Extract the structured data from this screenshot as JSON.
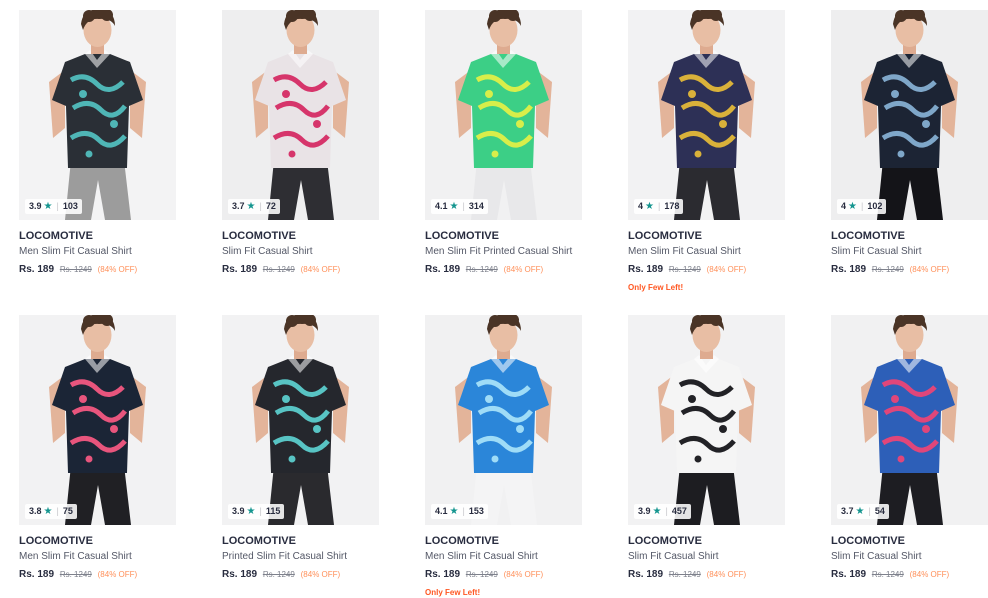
{
  "products": [
    {
      "brand": "LOCOMOTIVE",
      "name": "Men Slim Fit Casual Shirt",
      "price": "Rs. 189",
      "mrp": "Rs. 1249",
      "discount": "(84% OFF)",
      "rating": "3.9",
      "count": "103",
      "stock": "",
      "bg": "#f3f3f4",
      "shirt": "#2a2f36",
      "accent": "#4fb6b6",
      "pants": "#9c9c9c"
    },
    {
      "brand": "LOCOMOTIVE",
      "name": "Slim Fit Casual Shirt",
      "price": "Rs. 189",
      "mrp": "Rs. 1249",
      "discount": "(84% OFF)",
      "rating": "3.7",
      "count": "72",
      "stock": "",
      "bg": "#eeeeef",
      "shirt": "#e9e3e6",
      "accent": "#d6356b",
      "pants": "#2e2e33"
    },
    {
      "brand": "LOCOMOTIVE",
      "name": "Men Slim Fit Printed Casual Shirt",
      "price": "Rs. 189",
      "mrp": "Rs. 1249",
      "discount": "(84% OFF)",
      "rating": "4.1",
      "count": "314",
      "stock": "",
      "bg": "#f1f1f2",
      "shirt": "#3ccf86",
      "accent": "#d8ee4a",
      "pants": "#e8e8ea"
    },
    {
      "brand": "LOCOMOTIVE",
      "name": "Men Slim Fit Casual Shirt",
      "price": "Rs. 189",
      "mrp": "Rs. 1249",
      "discount": "(84% OFF)",
      "rating": "4",
      "count": "178",
      "stock": "Only Few Left!",
      "bg": "#f2f2f3",
      "shirt": "#2d3056",
      "accent": "#d9b13a",
      "pants": "#2b2b30"
    },
    {
      "brand": "LOCOMOTIVE",
      "name": "Slim Fit Casual Shirt",
      "price": "Rs. 189",
      "mrp": "Rs. 1249",
      "discount": "(84% OFF)",
      "rating": "4",
      "count": "102",
      "stock": "",
      "bg": "#eeeeef",
      "shirt": "#1c2434",
      "accent": "#7fa7c9",
      "pants": "#141418"
    },
    {
      "brand": "LOCOMOTIVE",
      "name": "Men Slim Fit Casual Shirt",
      "price": "Rs. 189",
      "mrp": "Rs. 1249",
      "discount": "(84% OFF)",
      "rating": "3.8",
      "count": "75",
      "stock": "",
      "bg": "#f2f2f3",
      "shirt": "#1b2536",
      "accent": "#e8557d",
      "pants": "#202024"
    },
    {
      "brand": "LOCOMOTIVE",
      "name": "Printed Slim Fit Casual Shirt",
      "price": "Rs. 189",
      "mrp": "Rs. 1249",
      "discount": "(84% OFF)",
      "rating": "3.9",
      "count": "115",
      "stock": "",
      "bg": "#f2f2f3",
      "shirt": "#25272d",
      "accent": "#58c4c4",
      "pants": "#2a2a2e"
    },
    {
      "brand": "LOCOMOTIVE",
      "name": "Men Slim Fit Casual Shirt",
      "price": "Rs. 189",
      "mrp": "Rs. 1249",
      "discount": "(84% OFF)",
      "rating": "4.1",
      "count": "153",
      "stock": "Only Few Left!",
      "bg": "#f1f1f2",
      "shirt": "#2b86d9",
      "accent": "#9fdcf7",
      "pants": "#f4f4f5"
    },
    {
      "brand": "LOCOMOTIVE",
      "name": "Slim Fit Casual Shirt",
      "price": "Rs. 189",
      "mrp": "Rs. 1249",
      "discount": "(84% OFF)",
      "rating": "3.9",
      "count": "457",
      "stock": "",
      "bg": "#f2f2f3",
      "shirt": "#f5f5f5",
      "accent": "#222226",
      "pants": "#1d1d21"
    },
    {
      "brand": "LOCOMOTIVE",
      "name": "Slim Fit Casual Shirt",
      "price": "Rs. 189",
      "mrp": "Rs. 1249",
      "discount": "(84% OFF)",
      "rating": "3.7",
      "count": "54",
      "stock": "",
      "bg": "#f1f1f2",
      "shirt": "#2d5fb8",
      "accent": "#e0467a",
      "pants": "#1d1d22"
    }
  ],
  "colors": {
    "star": "#14958f",
    "discount": "#ff905a",
    "stock": "#ff5722"
  }
}
